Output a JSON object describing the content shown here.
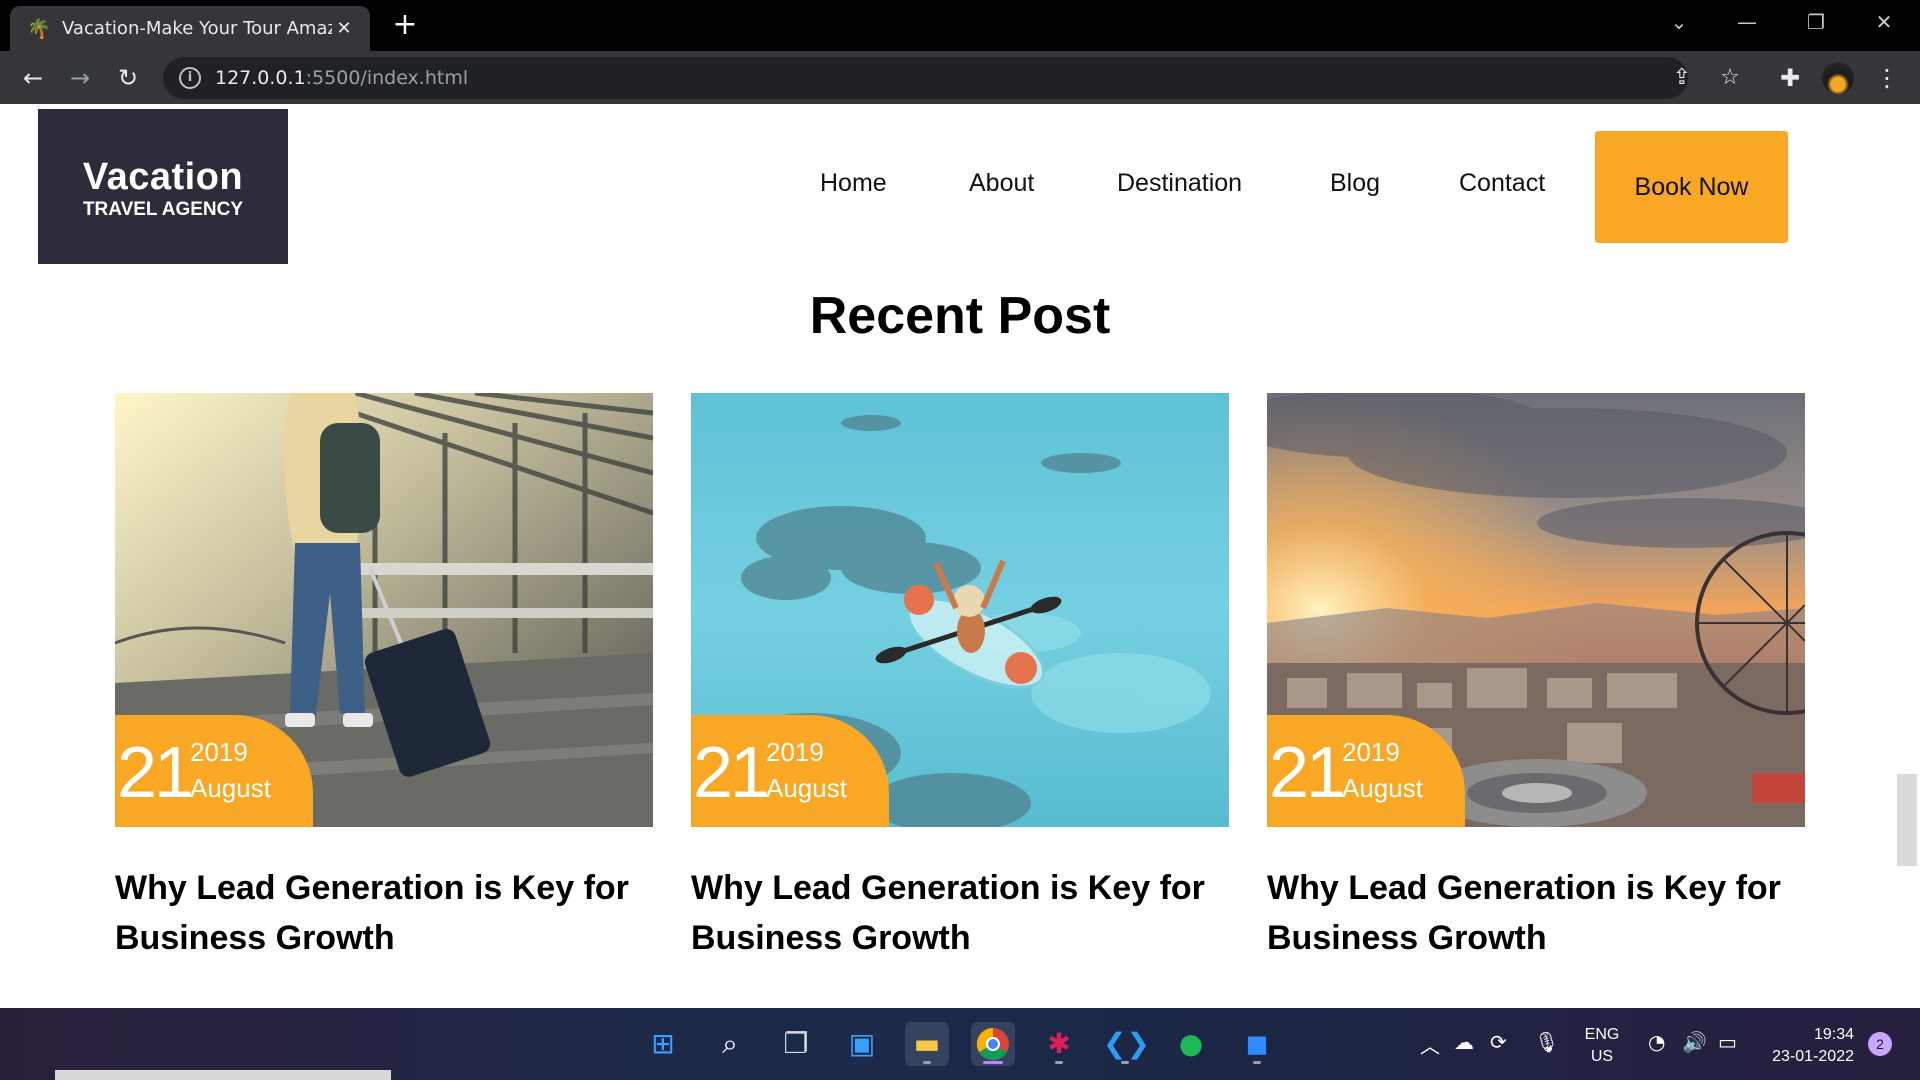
{
  "browser": {
    "tab_title": "Vacation-Make Your Tour Amazin",
    "url_host": "127.0.0.1",
    "url_path": ":5500/index.html"
  },
  "site": {
    "logo_title": "Vacation",
    "logo_subtitle": "TRAVEL AGENCY",
    "nav": [
      "Home",
      "About",
      "Destination",
      "Blog",
      "Contact"
    ],
    "book_button": "Book Now",
    "accent_color": "#f9a826",
    "section_title": "Recent Post",
    "posts": [
      {
        "day": "21",
        "year": "2019",
        "month": "August",
        "title": "Why Lead Generation is Key for Business Growth",
        "image": "airport-traveler-with-suitcase"
      },
      {
        "day": "21",
        "year": "2019",
        "month": "August",
        "title": "Why Lead Generation is Key for Business Growth",
        "image": "kayak-on-turquoise-water"
      },
      {
        "day": "21",
        "year": "2019",
        "month": "August",
        "title": "Why Lead Generation is Key for Business Growth",
        "image": "city-sunset-ferris-wheel"
      }
    ]
  },
  "taskbar": {
    "apps": [
      "start-icon",
      "search-icon",
      "task-view-icon",
      "widgets-icon",
      "file-explorer-icon",
      "chrome-icon",
      "slack-icon",
      "vscode-icon",
      "spotify-icon",
      "zoom-icon"
    ],
    "lang_line1": "ENG",
    "lang_line2": "US",
    "time": "19:34",
    "date": "23-01-2022",
    "notifications": "2"
  }
}
